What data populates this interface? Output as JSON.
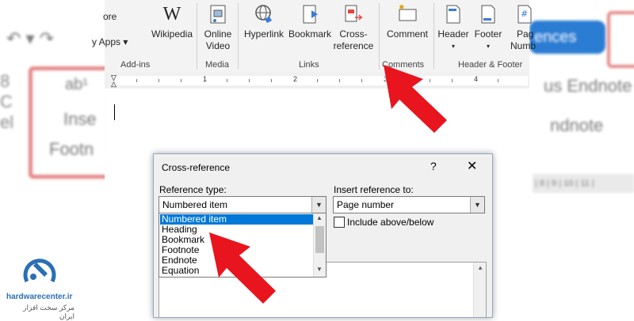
{
  "ribbon": {
    "add_ins": {
      "store": "ore",
      "my_apps": "y Apps",
      "wikipedia": "Wikipedia",
      "label": "Add-ins"
    },
    "media": {
      "online_video_l1": "Online",
      "online_video_l2": "Video",
      "label": "Media"
    },
    "links": {
      "hyperlink": "Hyperlink",
      "bookmark": "Bookmark",
      "cross_ref_l1": "Cross-",
      "cross_ref_l2": "reference",
      "label": "Links"
    },
    "comments": {
      "comment": "Comment",
      "label": "Comments"
    },
    "header_footer": {
      "header": "Header",
      "footer": "Footer",
      "page_num_l1": "Pag",
      "page_num_l2": "Numb",
      "label": "Header & Footer"
    }
  },
  "ruler": {
    "marks": [
      "1",
      "2",
      "3",
      "4"
    ]
  },
  "background": {
    "left_text": [
      "Inse",
      "Footn"
    ],
    "right_tab": "ences",
    "right_text": [
      "us Endnote",
      "ndnote"
    ]
  },
  "dialog": {
    "title": "Cross-reference",
    "help": "?",
    "close": "✕",
    "reference_type_label": "Reference type:",
    "reference_type_value": "Numbered item",
    "insert_reference_label": "Insert reference to:",
    "insert_reference_value": "Page number",
    "include_label": "Include above/below",
    "options": [
      "Numbered item",
      "Heading",
      "Bookmark",
      "Footnote",
      "Endnote",
      "Equation"
    ]
  },
  "watermark": {
    "site": "hardwarecenter.ir",
    "tagline": "مرکز سخت افزار ایران"
  },
  "colors": {
    "arrow": "#e8141e",
    "accent": "#0078d7",
    "brand": "#2a6fb5",
    "ribbon_tab": "#2b7cd3"
  }
}
